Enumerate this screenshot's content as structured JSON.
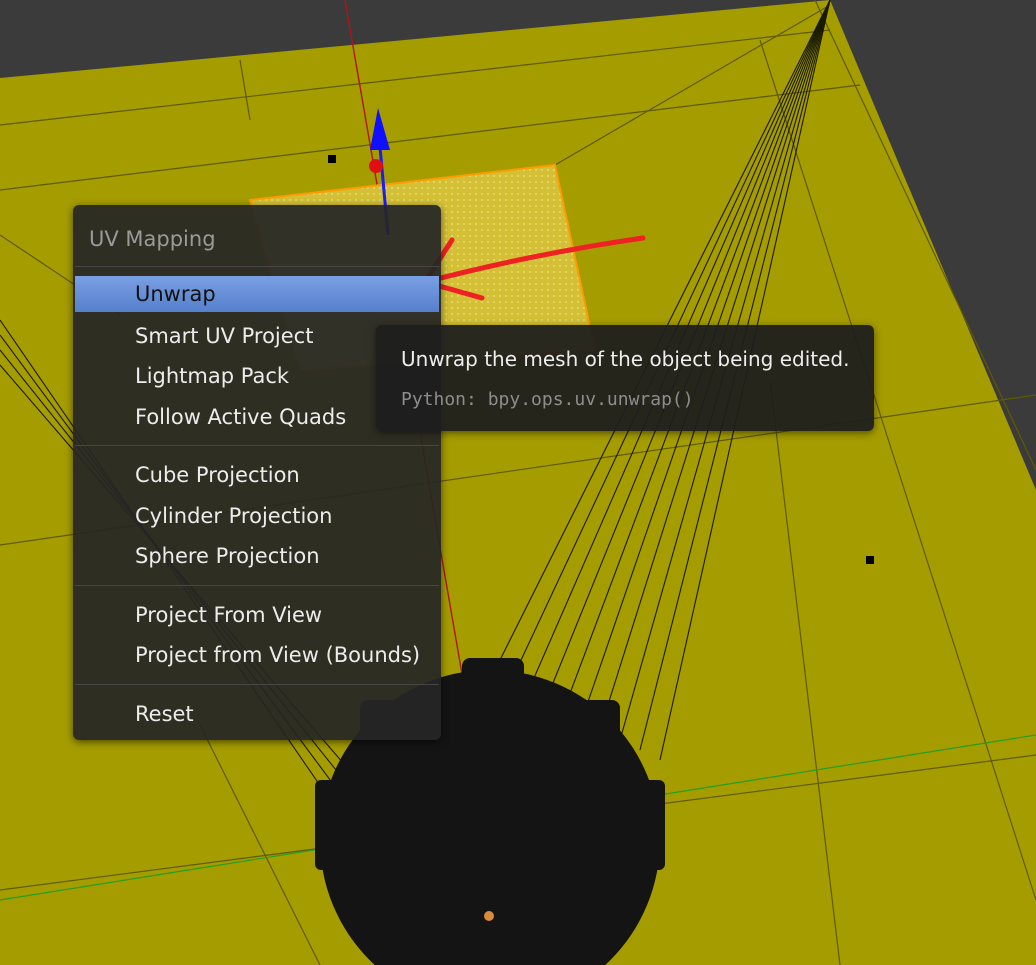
{
  "menu": {
    "title": "UV Mapping",
    "items": [
      {
        "label": "Unwrap",
        "active": true
      },
      {
        "label": "Smart UV Project"
      },
      {
        "label": "Lightmap Pack"
      },
      {
        "label": "Follow Active Quads"
      },
      {
        "label": "Cube Projection"
      },
      {
        "label": "Cylinder Projection"
      },
      {
        "label": "Sphere Projection"
      },
      {
        "label": "Project From View"
      },
      {
        "label": "Project from View (Bounds)"
      },
      {
        "label": "Reset"
      }
    ]
  },
  "tooltip": {
    "description": "Unwrap the mesh of the object being edited.",
    "python": "Python: bpy.ops.uv.unwrap()"
  },
  "colors": {
    "viewport_background": "#3b3b3b",
    "ground_plane": "#a59c00",
    "selected_face": "#d7c33a",
    "selection_outline": "#ff9b00",
    "active_item": "#5f8ad6",
    "annotation_arrow": "#ee2222"
  },
  "icons": {
    "gizmo": "transform-gizmo-icon"
  }
}
